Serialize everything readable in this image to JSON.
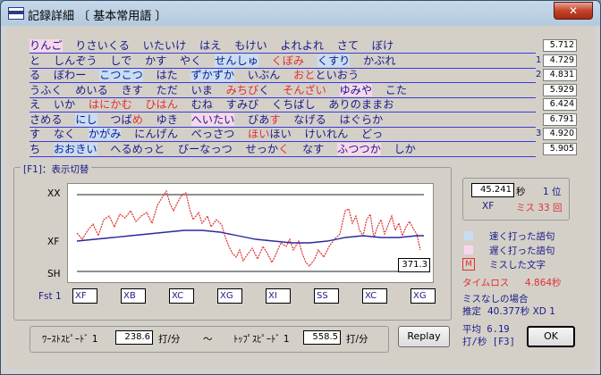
{
  "window": {
    "title": "記録詳細 〔 基本常用語 〕",
    "close_label": "✕"
  },
  "rows": [
    {
      "segments": [
        {
          "t": "りんご",
          "c": "slow"
        },
        {
          "t": "  りさいくる  いたいけ  はえ  もけい  よれよれ  さて  ぼけ",
          "c": ""
        }
      ],
      "score": "5.712",
      "num": ""
    },
    {
      "segments": [
        {
          "t": "と  しんぞう  しで  かす  やく  ",
          "c": ""
        },
        {
          "t": "せんしゅ",
          "c": "fast"
        },
        {
          "t": "  ",
          "c": ""
        },
        {
          "t": "くぼみ",
          "c": "miss"
        },
        {
          "t": "  ",
          "c": ""
        },
        {
          "t": "くすり",
          "c": "fast"
        },
        {
          "t": "  かぶれ",
          "c": ""
        }
      ],
      "score": "4.729",
      "num": "1"
    },
    {
      "segments": [
        {
          "t": "る  ぼわー  ",
          "c": ""
        },
        {
          "t": "こつこつ",
          "c": "fast"
        },
        {
          "t": "  はた  ",
          "c": ""
        },
        {
          "t": "ずかずか",
          "c": "fast"
        },
        {
          "t": "  いぶん  ",
          "c": ""
        },
        {
          "t": "おと",
          "c": "miss"
        },
        {
          "t": "といおう",
          "c": ""
        }
      ],
      "score": "4.831",
      "num": "2"
    },
    {
      "segments": [
        {
          "t": "うふく  めいる  きす  ただ  いま  ",
          "c": ""
        },
        {
          "t": "みちび",
          "c": "miss"
        },
        {
          "t": "く  ",
          "c": ""
        },
        {
          "t": "そんざい",
          "c": "miss"
        },
        {
          "t": "  ",
          "c": ""
        },
        {
          "t": "ゆみや",
          "c": "slow"
        },
        {
          "t": "  こた",
          "c": ""
        }
      ],
      "score": "5.929",
      "num": ""
    },
    {
      "segments": [
        {
          "t": "え  いか  ",
          "c": ""
        },
        {
          "t": "はにかむ",
          "c": "miss"
        },
        {
          "t": "  ",
          "c": ""
        },
        {
          "t": "ひはん",
          "c": "miss"
        },
        {
          "t": "  むね  すみび  くちばし  ありのままお",
          "c": ""
        }
      ],
      "score": "6.424",
      "num": ""
    },
    {
      "segments": [
        {
          "t": "さめる  ",
          "c": ""
        },
        {
          "t": "にし",
          "c": "fast"
        },
        {
          "t": "  つば",
          "c": ""
        },
        {
          "t": "め",
          "c": "miss"
        },
        {
          "t": "  ゆき  ",
          "c": ""
        },
        {
          "t": "へいたい",
          "c": "slow"
        },
        {
          "t": "  びあ",
          "c": ""
        },
        {
          "t": "す",
          "c": "miss"
        },
        {
          "t": "  なげる  はぐらか",
          "c": ""
        }
      ],
      "score": "6.791",
      "num": ""
    },
    {
      "segments": [
        {
          "t": "す  なく  ",
          "c": ""
        },
        {
          "t": "かがみ",
          "c": "fast"
        },
        {
          "t": "  にんげん  べっさつ  ",
          "c": ""
        },
        {
          "t": "ほい",
          "c": "miss"
        },
        {
          "t": "ほい  けいれん  どっ",
          "c": ""
        }
      ],
      "score": "4.920",
      "num": "3"
    },
    {
      "segments": [
        {
          "t": "ち  ",
          "c": ""
        },
        {
          "t": "おおきい",
          "c": "fast"
        },
        {
          "t": "  へるめっと  びーなっつ  せっか",
          "c": ""
        },
        {
          "t": "く",
          "c": "miss"
        },
        {
          "t": "  なす  ",
          "c": ""
        },
        {
          "t": "ふつつか",
          "c": "slow"
        },
        {
          "t": "  しか",
          "c": ""
        }
      ],
      "score": "5.905",
      "num": ""
    }
  ],
  "panel": {
    "label": "[F1]：表示切替"
  },
  "graph": {
    "axis_top": "XX",
    "axis_mid": "XF",
    "axis_bottom": "SH",
    "value": "371.3"
  },
  "fst": {
    "label": "Fst 1",
    "values": [
      "XF",
      "XB",
      "XC",
      "XG",
      "XI",
      "SS",
      "XC",
      "XG"
    ]
  },
  "result": {
    "time": "45.241",
    "time_unit": "秒",
    "rank": "1 位",
    "grade": "XF",
    "miss": "ミス 33 回"
  },
  "legend": {
    "fast": "速く打った語句",
    "slow": "遅く打った語句",
    "miss_mark": "M",
    "miss": "ミスした文字"
  },
  "timeloss": {
    "label": "タイムロス",
    "value": "4.864秒"
  },
  "nomiss": {
    "label": "ミスなしの場合",
    "estimate_label": "推定",
    "estimate_value": "40.377秒 XD 1"
  },
  "average": {
    "line1": "平均 6.19",
    "line2": "打/秒 [F3]"
  },
  "speed": {
    "worst_label": "ﾜｰｽﾄｽﾋﾟｰﾄﾞ 1",
    "worst_value": "238.6",
    "top_label": "ﾄｯﾌﾟｽﾋﾟｰﾄﾞ 1",
    "top_value": "558.5",
    "unit": "打/分",
    "tilde": "～"
  },
  "buttons": {
    "replay": "Replay",
    "ok": "OK"
  },
  "colors": {
    "text_blue": "#1a1a8a",
    "fast": "#c7def4",
    "slow": "#f8d7ea",
    "miss": "#e03030",
    "line_red": "#e03030",
    "line_blue": "#2a2a9a"
  }
}
